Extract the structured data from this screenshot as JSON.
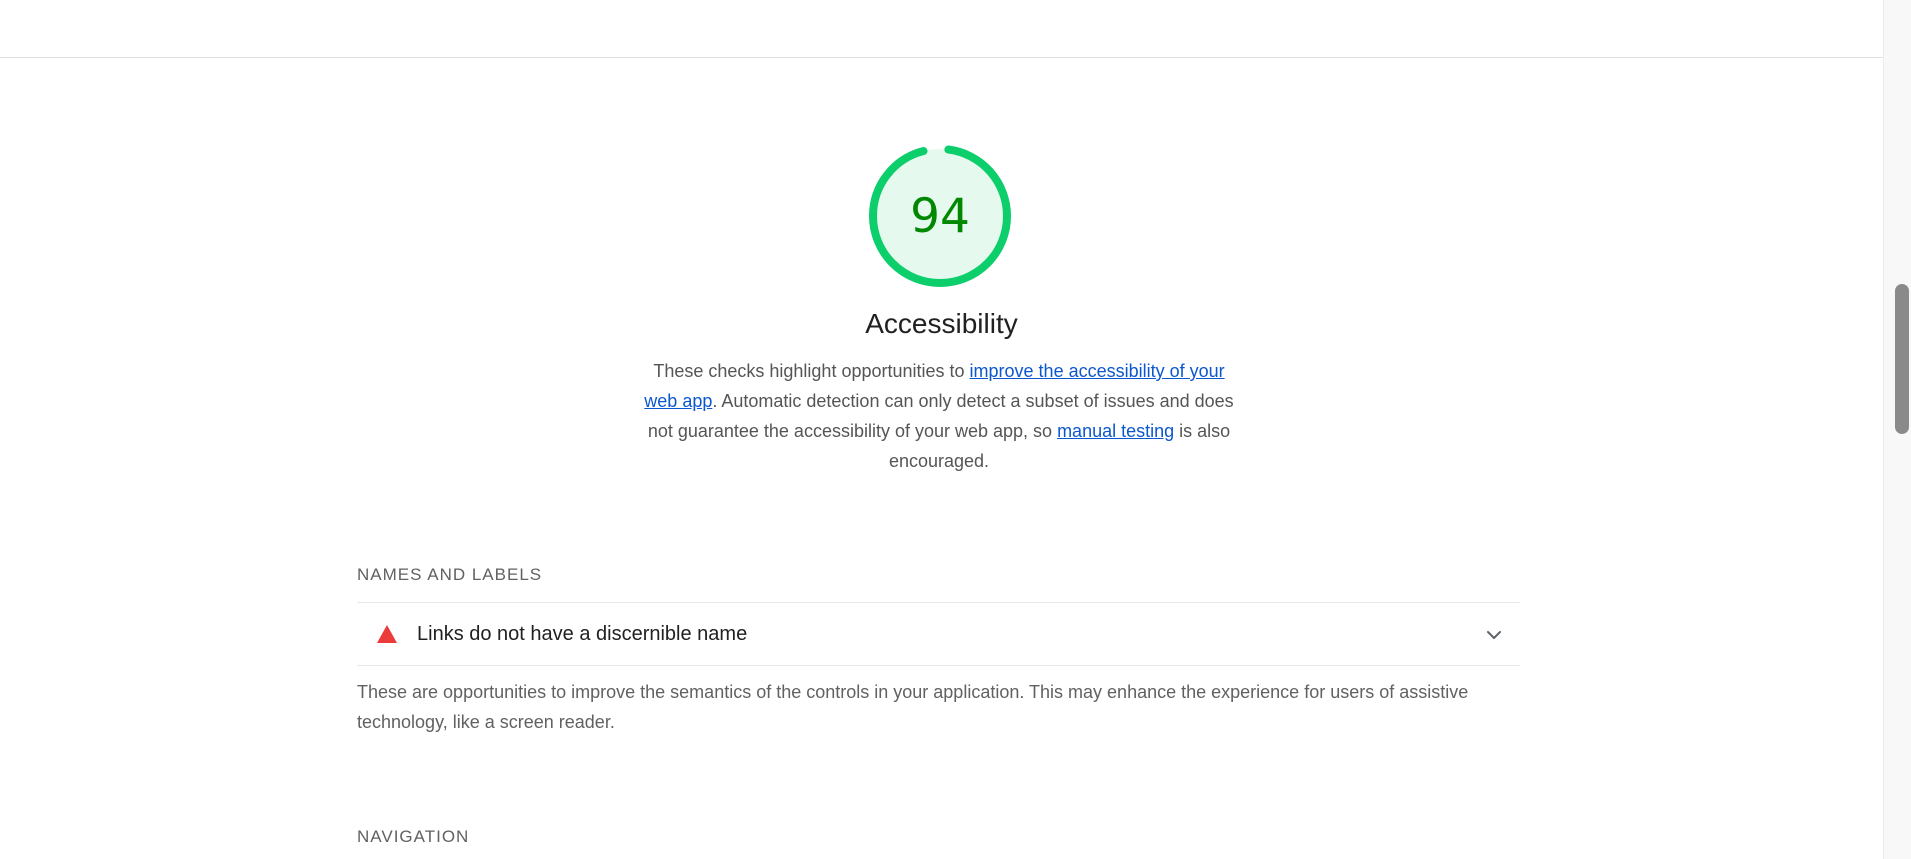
{
  "colors": {
    "pass_green": "#0cce6b",
    "pass_text": "#008800",
    "pass_fill": "#e6f9ee",
    "fail_red": "#eb3b3b",
    "link_blue": "#0b57d0"
  },
  "category": {
    "score": "94",
    "score_value": 0.94,
    "title": "Accessibility",
    "description": {
      "text_1": "These checks highlight opportunities to ",
      "link_1": "improve the accessibility of your web app",
      "text_2": ". Automatic detection can only detect a subset of issues and does not guarantee the accessibility of your web app, so ",
      "link_2": "manual testing",
      "text_3": " is also encouraged."
    }
  },
  "groups": [
    {
      "title": "NAMES AND LABELS",
      "audits": [
        {
          "status_icon": "fail-triangle-icon",
          "title": "Links do not have a discernible name",
          "expand_icon": "chevron-down-icon"
        }
      ],
      "description": "These are opportunities to improve the semantics of the controls in your application. This may enhance the experience for users of assistive technology, like a screen reader."
    },
    {
      "title": "NAVIGATION"
    }
  ]
}
